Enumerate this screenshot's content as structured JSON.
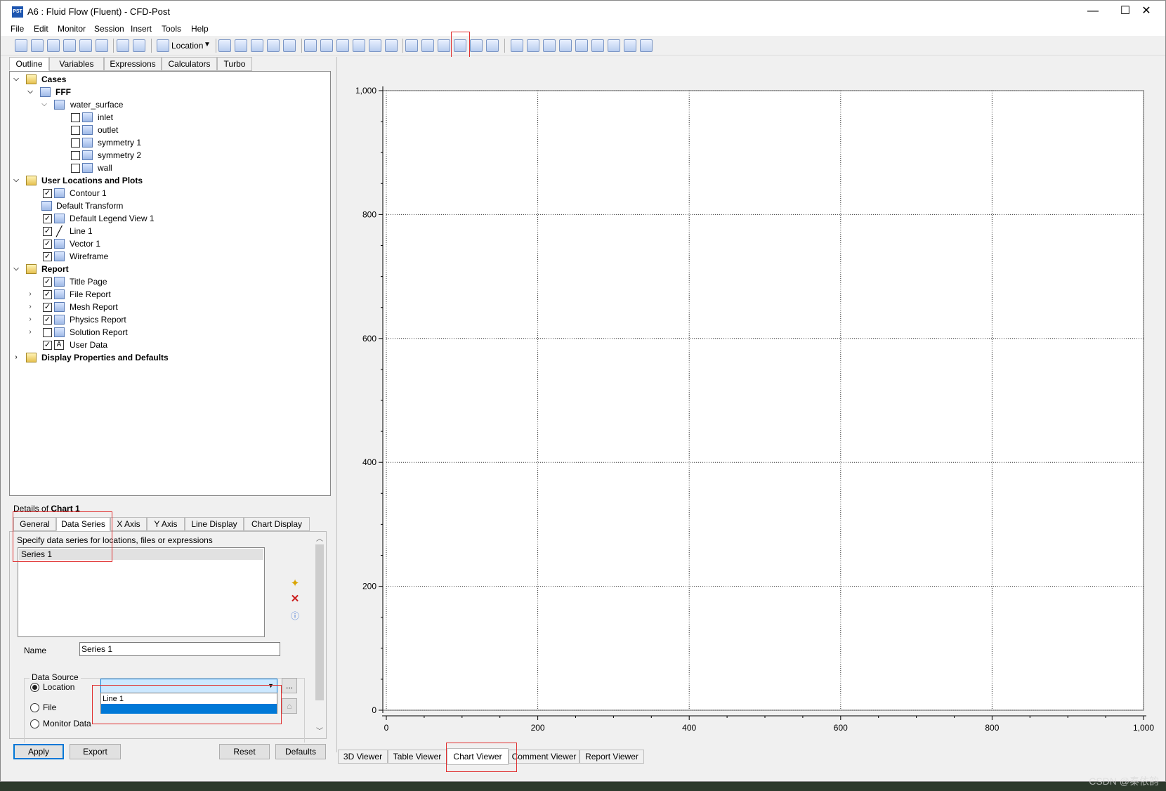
{
  "window": {
    "app_icon_text": "PST",
    "title": "A6 : Fluid Flow (Fluent) - CFD-Post",
    "min_glyph": "—",
    "max_glyph": "☐",
    "close_glyph": "✕"
  },
  "menu": [
    "File",
    "Edit",
    "Monitor",
    "Session",
    "Insert",
    "Tools",
    "Help"
  ],
  "toolbar": {
    "location_label": "Location",
    "highlighted_tool": "chart-icon"
  },
  "outline_tabs": [
    "Outline",
    "Variables",
    "Expressions",
    "Calculators",
    "Turbo"
  ],
  "tree": {
    "cases": "Cases",
    "fff": "FFF",
    "water_surface": "water_surface",
    "boundaries": [
      "inlet",
      "outlet",
      "symmetry 1",
      "symmetry 2",
      "wall"
    ],
    "user_locations": "User Locations and Plots",
    "user_items": [
      "Contour 1",
      "Default Transform",
      "Default Legend View 1",
      "Line 1",
      "Vector 1",
      "Wireframe"
    ],
    "report": "Report",
    "report_items": [
      "Title Page",
      "File Report",
      "Mesh Report",
      "Physics Report",
      "Solution Report",
      "User Data"
    ],
    "display": "Display Properties and Defaults"
  },
  "details": {
    "title_prefix": "Details of ",
    "title_object": "Chart 1",
    "tabs": [
      "General",
      "Data Series",
      "X Axis",
      "Y Axis",
      "Line Display",
      "Chart Display"
    ],
    "hint": "Specify data series for locations, files or expressions",
    "series": [
      "Series 1"
    ],
    "name_label": "Name",
    "name_value": "Series 1",
    "data_source_label": "Data Source",
    "location_label": "Location",
    "file_label": "File",
    "monitor_label": "Monitor Data",
    "location_value": "",
    "dropdown_options": [
      "Line 1",
      ""
    ],
    "dots": "...",
    "buttons": {
      "apply": "Apply",
      "export": "Export",
      "reset": "Reset",
      "defaults": "Defaults"
    }
  },
  "viewer_tabs": [
    "3D Viewer",
    "Table Viewer",
    "Chart Viewer",
    "Comment Viewer",
    "Report Viewer"
  ],
  "chart_data": {
    "type": "line",
    "title": "",
    "xlabel": "",
    "ylabel": "",
    "xlim": [
      0,
      1000
    ],
    "ylim": [
      0,
      1000
    ],
    "x_ticks": [
      "0",
      "200",
      "400",
      "600",
      "800",
      "1,000"
    ],
    "y_ticks": [
      "0",
      "200",
      "400",
      "600",
      "800",
      "1,000"
    ],
    "grid": true,
    "series": []
  },
  "watermark": "CSDN @秦依韵"
}
